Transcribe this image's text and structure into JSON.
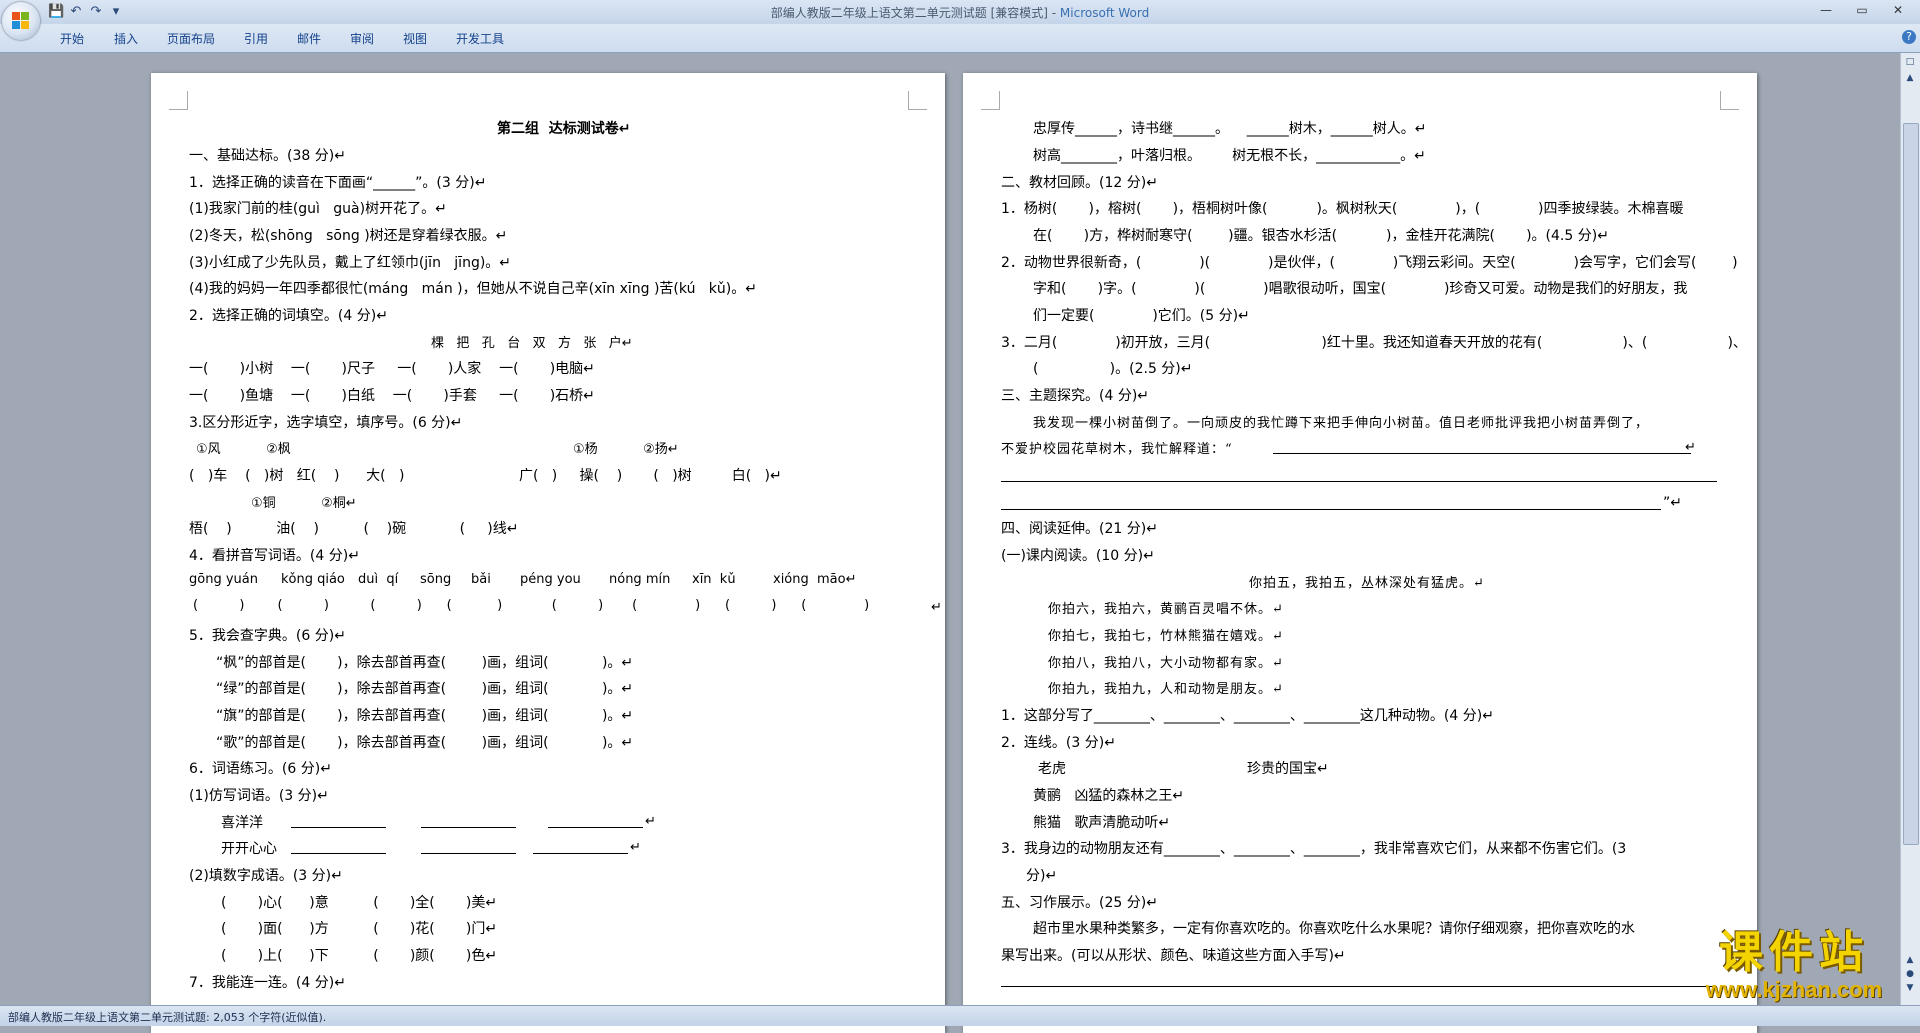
{
  "window": {
    "title_doc": "部编人教版二年级上语文第二单元测试题 [兼容模式] - ",
    "title_app": "Microsoft Word"
  },
  "ribbon_tabs": [
    "开始",
    "插入",
    "页面布局",
    "引用",
    "邮件",
    "审阅",
    "视图",
    "开发工具"
  ],
  "status_text": "部编人教版二年级上语文第二单元测试题: 2,053 个字符(近似值).",
  "watermark": {
    "main": "课件站",
    "url": "www.kjzhan.com"
  },
  "page1": {
    "lines": [
      "第二组  达标测试卷↵",
      "一、基础达标。(38 分)↵",
      "1．选择正确的读音在下面画“______”。(3 分)↵",
      "(1)我家门前的桂(guì   guà)树开花了。↵",
      "(2)冬天，松(shōng   sōng )树还是穿着绿衣服。↵",
      "(3)小红成了少先队员，戴上了红领巾(jīn   jīng)。↵",
      "(4)我的妈妈一年四季都很忙(máng   mán )，但她从不说自己辛(xīn xīng )苦(kú   kǔ)。↵",
      "2．选择正确的词填空。(4 分)↵",
      "棵   把   孔   台   双   方   张   户↵",
      "一(       )小树    一(       )尺子     一(       )人家    一(       )电脑↵",
      "一(       )鱼塘    一(       )白纸    一(       )手套     一(       )石桥↵",
      "3.区分形近字，选字填空，填序号。(6 分)↵",
      "①风           ②枫",
      "①杨           ②扬↵",
      "(   )车    (   )树   红(    )      大(   )",
      "广(   )     操(    )       (   )树         白(   )↵",
      "①铜           ②桐↵",
      "梧(    )          油(    )          (    )碗            (     )线↵",
      "4．看拼音写词语。(4 分)↵",
      "gōng yuán",
      "kǒng qiáo",
      "duì  qí",
      "sōng",
      "bǎi",
      "péng you",
      "nóng mín",
      "xīn  kǔ",
      "xióng  māo↵",
      "(          )        (          )          (          )      (           )            (          )       (              )      (          )      (              )",
      "↵",
      "5．我会查字典。(6 分)↵",
      "“枫”的部首是(       )，除去部首再查(        )画，组词(            )。↵",
      "“绿”的部首是(       )，除去部首再查(        )画，组词(            )。↵",
      "“旗”的部首是(       )，除去部首再查(        )画，组词(            )。↵",
      "“歌”的部首是(       )，除去部首再查(        )画，组词(            )。↵",
      "6．词语练习。(6 分)↵",
      "(1)仿写词语。(3 分)↵",
      "喜洋洋",
      "↵",
      "开开心心",
      "↵",
      "(2)填数字成语。(3 分)↵",
      "(       )心(      )意          (       )全(       )美↵",
      "(       )面(      )方          (       )花(       )门↵",
      "(       )上(      )下          (       )颜(       )色↵",
      "7．我能连一连。(4 分)↵"
    ]
  },
  "page2": {
    "lines": [
      "忠厚传______，诗书继______。    ______树木，______树人。↵",
      "树高________，叶落归根。       树无根不长，____________。↵",
      "二、教材回顾。(12 分)↵",
      "1．杨树(       )，榕树(       )，梧桐树叶像(           )。枫树秋天(             )，(             )四季披绿装。木棉喜暖",
      "在(       )方，桦树耐寒守(        )疆。银杏水杉活(           )，金桂开花满院(       )。(4.5 分)↵",
      "2．动物世界很新奇，(             )(             )是伙伴，(             )飞翔云彩间。天空(             )会写字，它们会写(        )",
      "字和(       )字。(             )(             )唱歌很动听，国宝(             )珍奇又可爱。动物是我们的好朋友，我",
      "们一定要(             )它们。(5 分)↵",
      "3．二月(             )初开放，三月(                         )红十里。我还知道春天开放的花有(                  )、(                  )、",
      "(                )。(2.5 分)↵",
      "三、主题探究。(4 分)↵",
      "我发现一棵小树苗倒了。一向顽皮的我忙蹲下来把手伸向小树苗。值日老师批评我把小树苗弄倒了，",
      "不爱护校园花草树木，我忙解释道：“",
      "↵",
      "”↵",
      "四、阅读延伸。(21 分)↵",
      "(一)课内阅读。(10 分)↵",
      "你拍五，我拍五，丛林深处有猛虎。↵",
      "你拍六，我拍六，黄鹂百灵唱不休。↵",
      "你拍七，我拍七，竹林熊猫在嬉戏。↵",
      "你拍八，我拍八，大小动物都有家。↵",
      "你拍九，我拍九，人和动物是朋友。↵",
      "1．这部分写了________、________、________、________这几种动物。(4 分)↵",
      "2．连线。(3 分)↵",
      "老虎",
      "珍贵的国宝↵",
      "黄鹂   凶猛的森林之王↵",
      "熊猫   歌声清脆动听↵",
      "3．我身边的动物朋友还有________、________、________，我非常喜欢它们，从来都不伤害它们。(3",
      "分)↵",
      "五、习作展示。(25 分)↵",
      "超市里水果种类繁多，一定有你喜欢吃的。你喜欢吃什么水果呢？请你仔细观察，把你喜欢吃的水",
      "果写出来。(可以从形状、颜色、味道这些方面入手写)↵"
    ]
  }
}
